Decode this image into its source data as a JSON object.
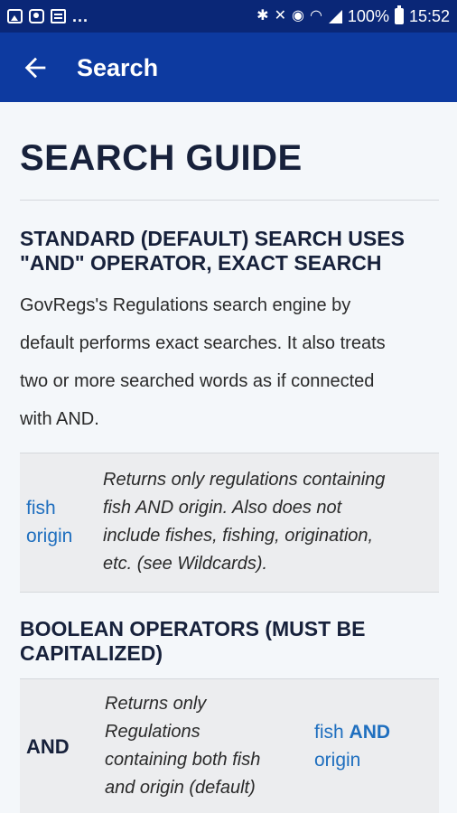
{
  "status_bar": {
    "more": "...",
    "battery": "100%",
    "time": "15:52",
    "icons_left": [
      "image-icon",
      "camera-icon",
      "message-icon"
    ],
    "icons_right": [
      "bluetooth-icon",
      "mute-icon",
      "alarm-icon",
      "wifi-icon",
      "signal-icon",
      "battery-icon"
    ]
  },
  "app_bar": {
    "title": "Search",
    "back_icon": "arrow-left-icon",
    "background": "#0d3aa0"
  },
  "guide": {
    "title": "SEARCH GUIDE",
    "section1": {
      "heading_line1": "STANDARD (DEFAULT) SEARCH USES",
      "heading_line2": "\"AND\" OPERATOR, EXACT SEARCH",
      "para_lines": [
        "GovRegs's Regulations search engine by",
        "default performs exact searches. It also treats",
        "two or more searched words as if connected",
        "with AND."
      ],
      "example": {
        "query_line1": "fish",
        "query_line2": "origin",
        "desc_lines": [
          "Returns only regulations containing",
          "fish AND origin. Also does not",
          "include fishes, fishing, origination,",
          "etc. (see Wildcards)."
        ]
      }
    },
    "section2": {
      "heading_line1": "BOOLEAN OPERATORS (MUST BE",
      "heading_line2": "CAPITALIZED)",
      "row": {
        "operator": "AND",
        "desc_lines": [
          "Returns only",
          "Regulations",
          "containing both fish",
          "and origin (default)"
        ],
        "example_word1": "fish",
        "example_op": "AND",
        "example_word2": "origin"
      }
    }
  },
  "colors": {
    "status_bar": "#0a2777",
    "link": "#1f6fbf",
    "heading": "#17213b"
  }
}
